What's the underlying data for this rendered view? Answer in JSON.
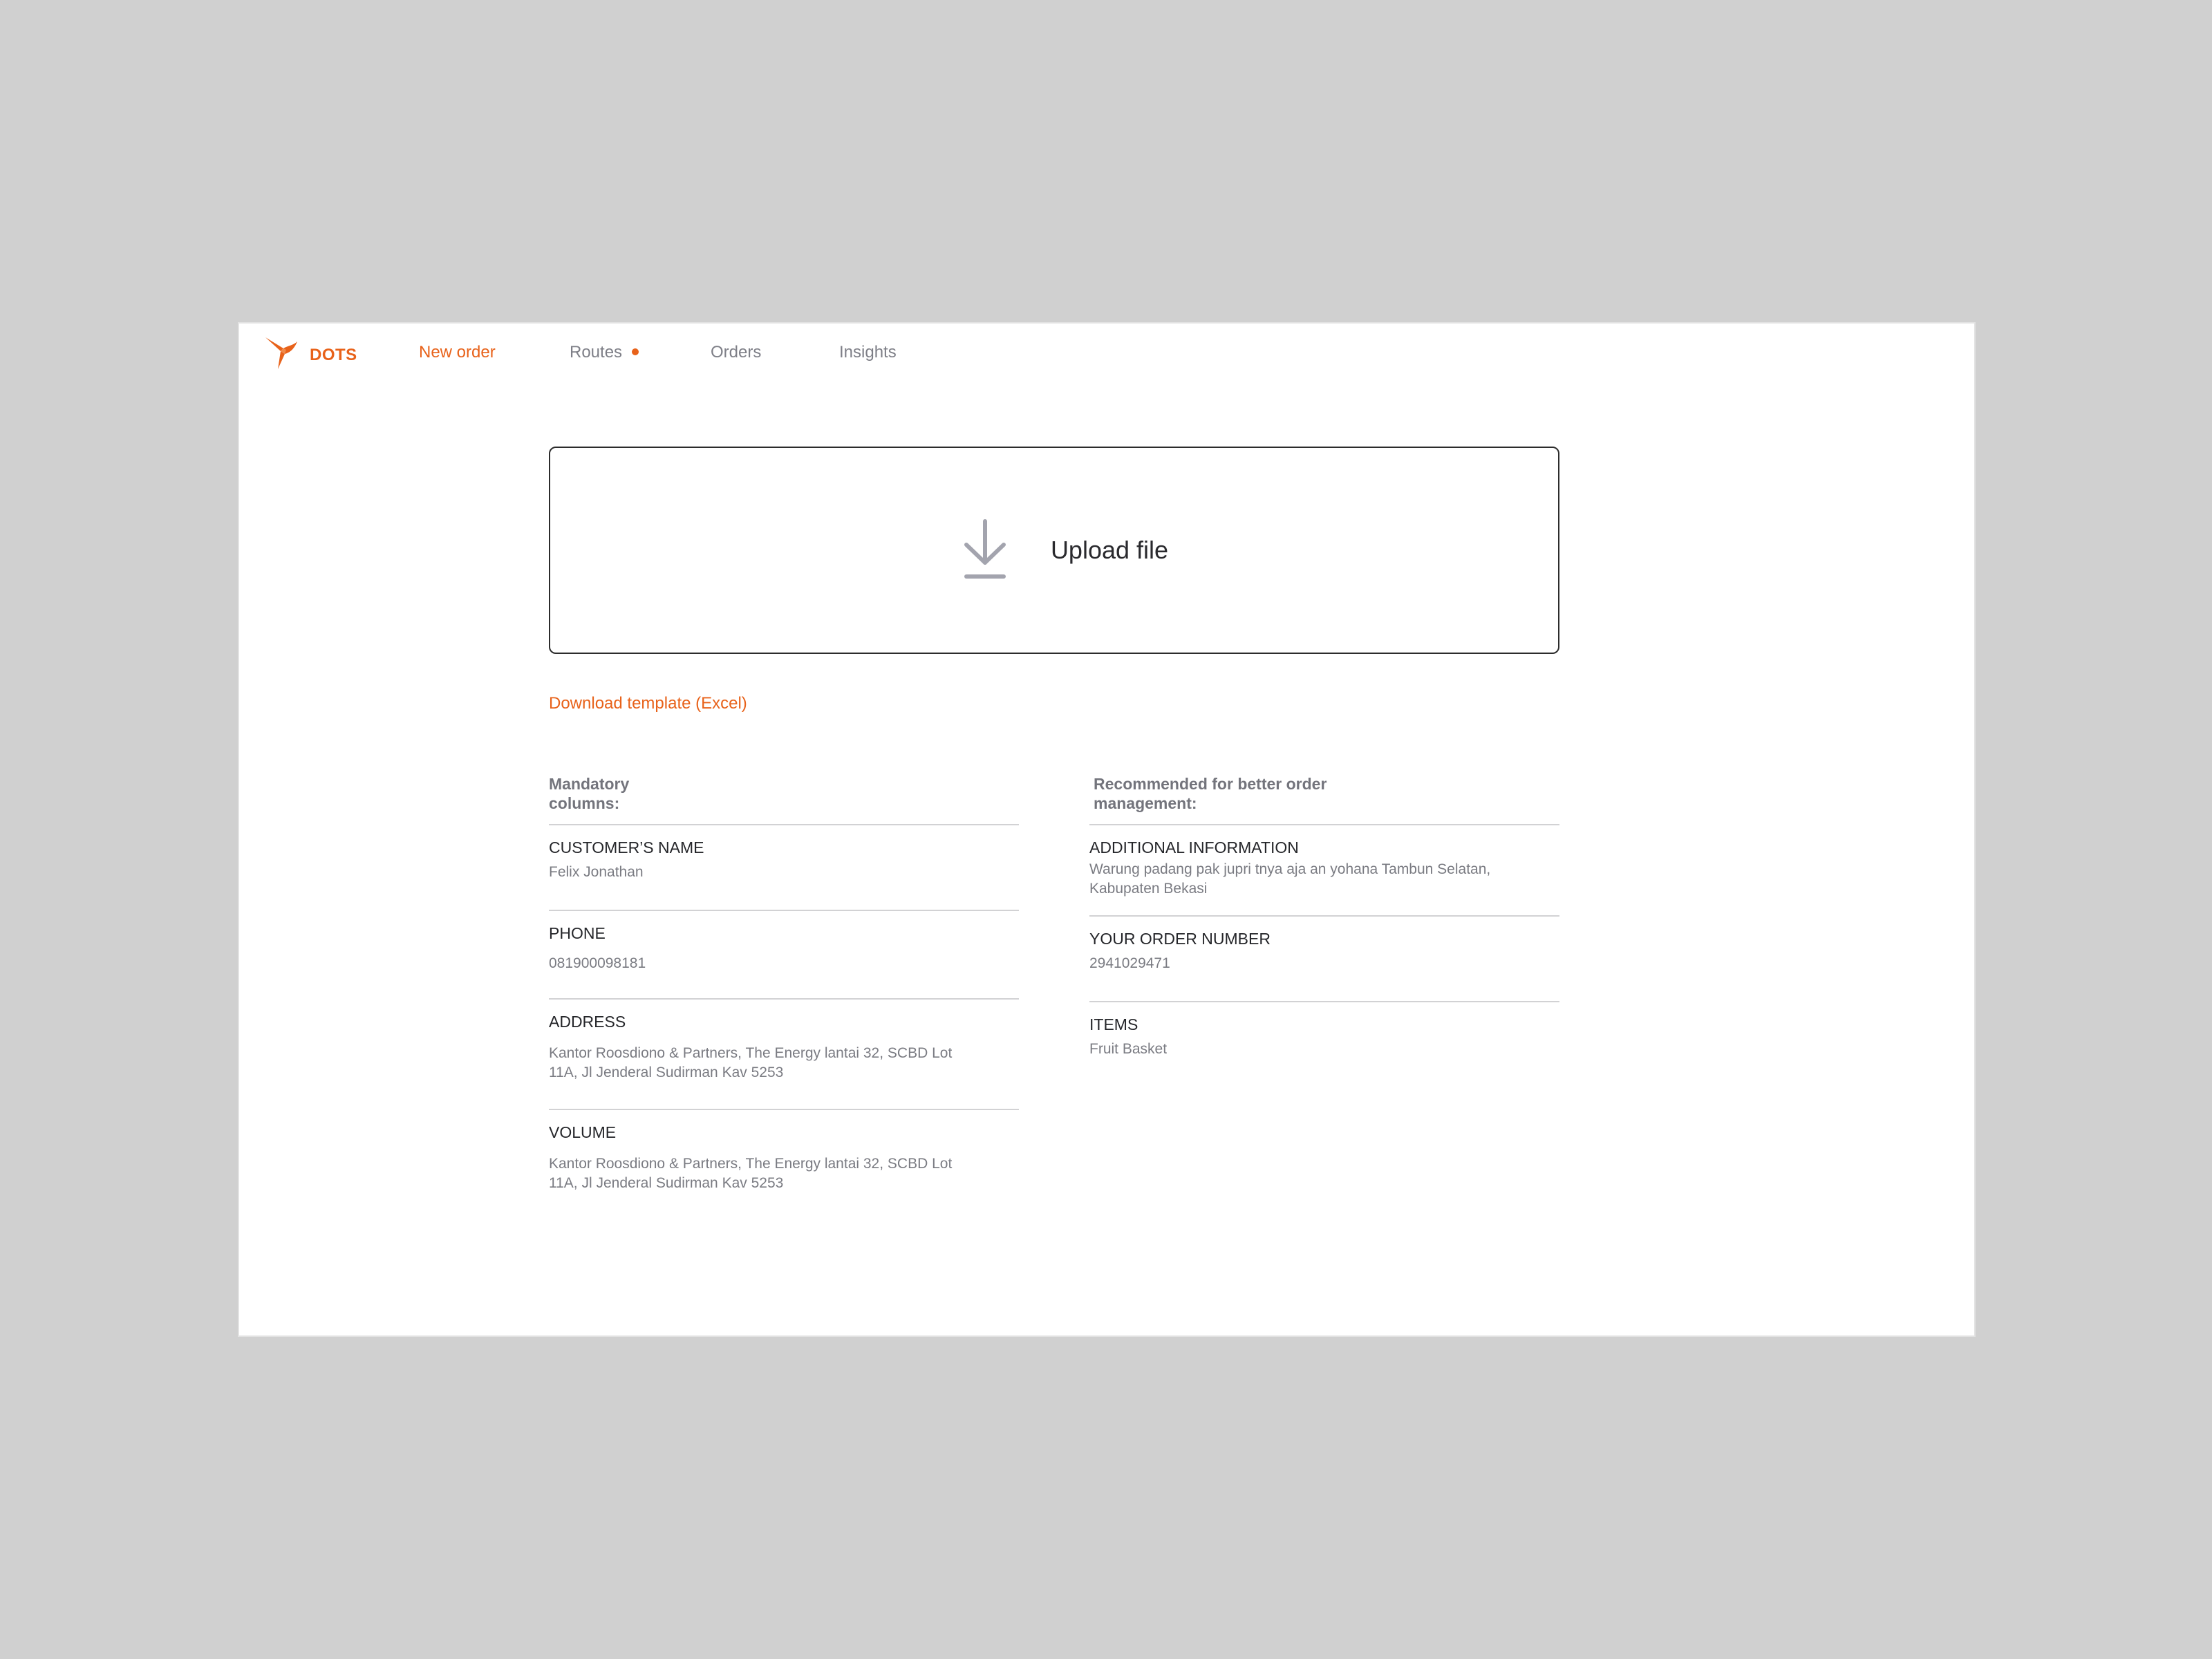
{
  "brand": {
    "name": "DOTS",
    "accent": "#e8621a"
  },
  "nav": {
    "items": [
      {
        "label": "New order",
        "active": true
      },
      {
        "label": "Routes",
        "badge": "dot"
      },
      {
        "label": "Orders"
      },
      {
        "label": "Insights"
      }
    ]
  },
  "upload": {
    "label": "Upload file",
    "icon": "download-icon"
  },
  "template_link": "Download template (Excel)",
  "mandatory": {
    "heading_line1": "Mandatory",
    "heading_line2": "columns:",
    "fields": [
      {
        "title": "CUSTOMER’S NAME",
        "value_line1": "Felix Jonathan",
        "value_line2": ""
      },
      {
        "title": "PHONE",
        "value_line1": "081900098181",
        "value_line2": ""
      },
      {
        "title": "ADDRESS",
        "value_line1": "Kantor Roosdiono & Partners, The Energy lantai 32, SCBD Lot",
        "value_line2": "11A, Jl Jenderal Sudirman Kav 5253"
      },
      {
        "title": "VOLUME",
        "value_line1": "Kantor Roosdiono & Partners, The Energy lantai 32, SCBD Lot",
        "value_line2": "11A, Jl Jenderal Sudirman Kav 5253"
      }
    ]
  },
  "recommended": {
    "heading_line1": "Recommended for better order",
    "heading_line2": "management:",
    "fields": [
      {
        "title": "ADDITIONAL INFORMATION",
        "value_line1": "Warung padang pak jupri tnya aja an yohana Tambun Selatan,",
        "value_line2": "Kabupaten Bekasi"
      },
      {
        "title": "YOUR ORDER NUMBER",
        "value_line1": "2941029471",
        "value_line2": ""
      },
      {
        "title": "ITEMS",
        "value_line1": "Fruit Basket",
        "value_line2": ""
      }
    ]
  }
}
